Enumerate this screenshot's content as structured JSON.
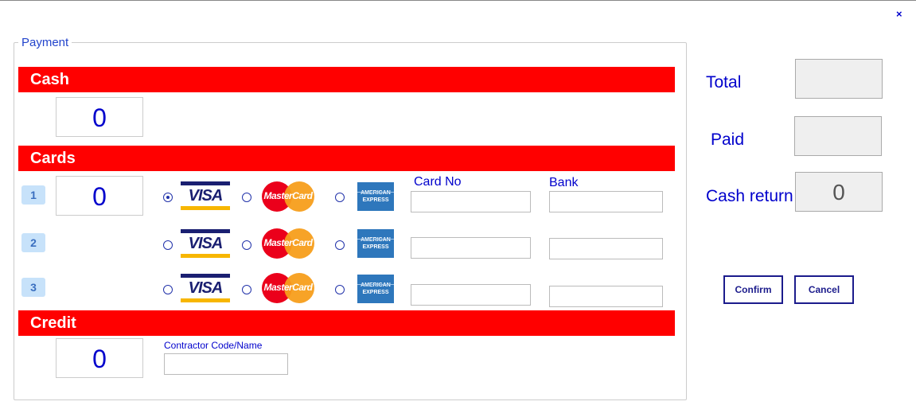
{
  "window": {
    "close_icon": "×"
  },
  "payment": {
    "legend": "Payment",
    "cash": {
      "header": "Cash",
      "amount": "0"
    },
    "cards": {
      "header": "Cards",
      "amount": "0",
      "card_no_label": "Card No",
      "bank_label": "Bank",
      "rows": [
        {
          "index": "1",
          "selected": "visa"
        },
        {
          "index": "2",
          "selected": ""
        },
        {
          "index": "3",
          "selected": ""
        }
      ],
      "brands": {
        "visa": "VISA",
        "mastercard": "MasterCard",
        "amex_line1": "AMERICAN",
        "amex_line2": "EXPRESS"
      }
    },
    "credit": {
      "header": "Credit",
      "amount": "0",
      "contractor_label": "Contractor Code/Name"
    }
  },
  "summary": {
    "total_label": "Total",
    "paid_label": "Paid",
    "cash_return_label": "Cash return",
    "cash_return_value": "0"
  },
  "actions": {
    "confirm": "Confirm",
    "cancel": "Cancel"
  },
  "colors": {
    "accent": "#0000cc",
    "section_bar": "#ff0000",
    "badge": "#c7e2fa"
  }
}
